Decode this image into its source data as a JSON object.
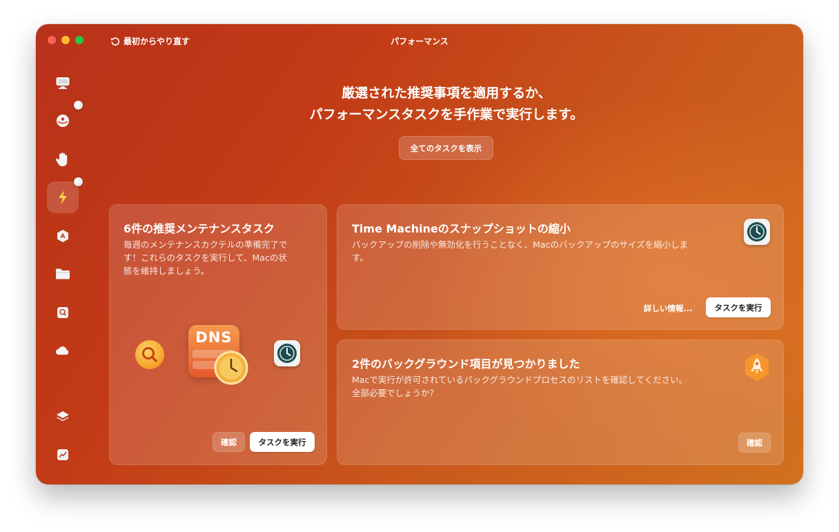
{
  "window": {
    "title": "パフォーマンス"
  },
  "toolbar": {
    "restart_label": "最初からやり直す"
  },
  "sidebar": {
    "items": [
      {
        "icon": "monitor-icon"
      },
      {
        "icon": "protection-icon",
        "badge": true
      },
      {
        "icon": "hand-privacy-icon"
      },
      {
        "icon": "lightning-performance-icon",
        "active": true,
        "badge": true
      },
      {
        "icon": "applications-icon"
      },
      {
        "icon": "folder-icon"
      },
      {
        "icon": "space-lens-icon"
      },
      {
        "icon": "cloud-icon"
      },
      {
        "icon": "layers-icon"
      },
      {
        "icon": "chart-icon"
      }
    ]
  },
  "header": {
    "line1": "厳選された推奨事項を適用するか、",
    "line2": "パフォーマンスタスクを手作業で実行します。",
    "show_all_label": "全てのタスクを表示"
  },
  "cards": {
    "maintenance": {
      "title": "6件の推奨メンテナンスタスク",
      "desc_lines": [
        "毎週のメンテナンスカクテルの準備完了で",
        "す！これらのタスクを実行して、Macの状",
        "態を維持しましょう。"
      ],
      "dns_label": "DNS",
      "review_label": "確認",
      "run_label": "タスクを実行"
    },
    "time_machine": {
      "title": "Time Machineのスナップショットの縮小",
      "desc_lines": [
        "バックアップの削除や無効化を行うことなく、Macのバックアップのサイズを縮小しま",
        "す。"
      ],
      "more_info_label": "詳しい情報...",
      "run_label": "タスクを実行"
    },
    "background": {
      "title": "2件のバックグラウンド項目が見つかりました",
      "desc_lines": [
        "Macで実行が許可されているバックグラウンドプロセスのリストを確認してください。",
        "全部必要でしょうか？"
      ],
      "review_label": "確認"
    }
  },
  "colors": {
    "bg_start": "#b8321a",
    "bg_end": "#d2711f",
    "dns_tile": "#f07840",
    "magnifier": "#f5a623",
    "rocket_tile": "#f7962c"
  }
}
